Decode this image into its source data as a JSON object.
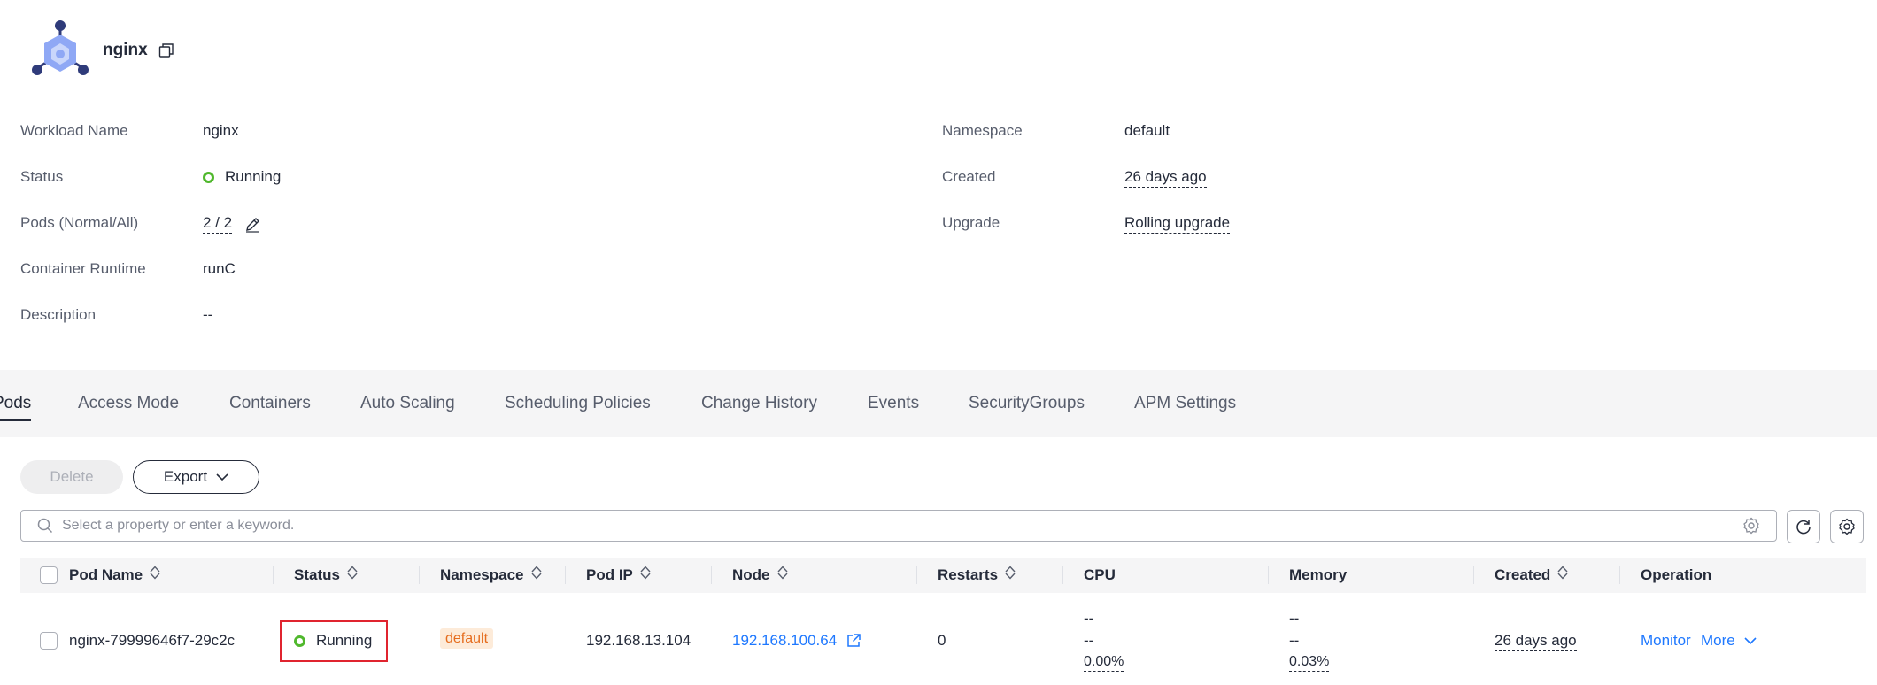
{
  "workload": {
    "name": "nginx"
  },
  "info_left": [
    {
      "label": "Workload Name",
      "value": "nginx"
    },
    {
      "label": "Status",
      "value": "Running"
    },
    {
      "label": "Pods (Normal/All)",
      "value": "2 / 2"
    },
    {
      "label": "Container Runtime",
      "value": "runC"
    },
    {
      "label": "Description",
      "value": "--"
    }
  ],
  "info_right": [
    {
      "label": "Namespace",
      "value": "default"
    },
    {
      "label": "Created",
      "value": "26 days ago"
    },
    {
      "label": "Upgrade",
      "value": "Rolling upgrade"
    }
  ],
  "tabs": [
    {
      "label": "Pods"
    },
    {
      "label": "Access Mode"
    },
    {
      "label": "Containers"
    },
    {
      "label": "Auto Scaling"
    },
    {
      "label": "Scheduling Policies"
    },
    {
      "label": "Change History"
    },
    {
      "label": "Events"
    },
    {
      "label": "SecurityGroups"
    },
    {
      "label": "APM Settings"
    }
  ],
  "toolbar": {
    "delete_label": "Delete",
    "export_label": "Export",
    "search_placeholder": "Select a property or enter a keyword."
  },
  "table": {
    "columns": [
      "Pod Name",
      "Status",
      "Namespace",
      "Pod IP",
      "Node",
      "Restarts",
      "CPU",
      "Memory",
      "Created",
      "Operation"
    ],
    "rows": [
      {
        "pod_name": "nginx-79999646f7-29c2c",
        "status": "Running",
        "namespace": "default",
        "pod_ip": "192.168.13.104",
        "node": "192.168.100.64",
        "restarts": "0",
        "cpu": {
          "line1": "--",
          "line2": "--",
          "usage": "0.00%"
        },
        "memory": {
          "line1": "--",
          "line2": "--",
          "usage": "0.03%"
        },
        "created": "26 days ago",
        "op_monitor": "Monitor",
        "op_more": "More"
      }
    ]
  },
  "colors": {
    "status_running": "#50b82d",
    "link": "#1e78ff",
    "badge_text": "#e56c1d",
    "badge_bg": "#fdebd9",
    "highlight": "#e0242f"
  }
}
